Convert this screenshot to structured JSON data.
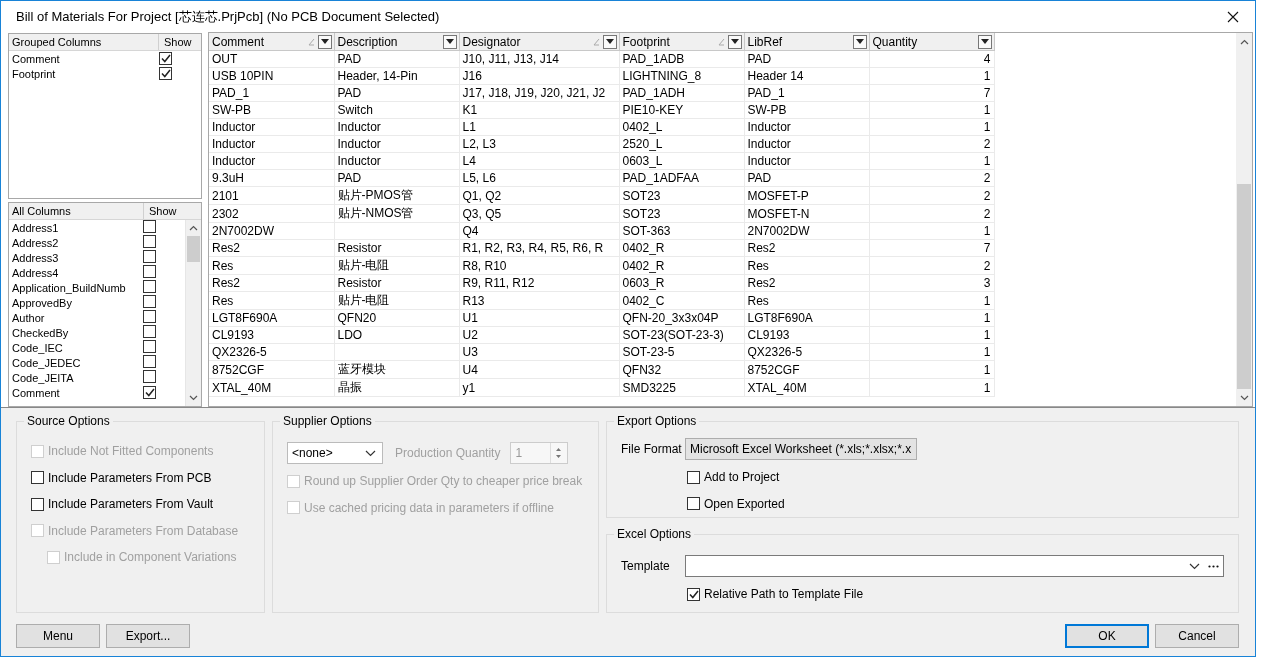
{
  "window": {
    "title": "Bill of Materials For Project [芯连芯.PrjPcb] (No PCB Document Selected)"
  },
  "grouped_columns": {
    "headers": [
      "Grouped Columns",
      "Show"
    ],
    "items": [
      {
        "label": "Comment",
        "checked": true
      },
      {
        "label": "Footprint",
        "checked": true
      }
    ]
  },
  "all_columns": {
    "headers": [
      "All Columns",
      "Show"
    ],
    "items": [
      {
        "label": "Address1",
        "checked": false
      },
      {
        "label": "Address2",
        "checked": false
      },
      {
        "label": "Address3",
        "checked": false
      },
      {
        "label": "Address4",
        "checked": false
      },
      {
        "label": "Application_BuildNumb",
        "checked": false
      },
      {
        "label": "ApprovedBy",
        "checked": false
      },
      {
        "label": "Author",
        "checked": false
      },
      {
        "label": "CheckedBy",
        "checked": false
      },
      {
        "label": "Code_IEC",
        "checked": false
      },
      {
        "label": "Code_JEDEC",
        "checked": false
      },
      {
        "label": "Code_JEITA",
        "checked": false
      },
      {
        "label": "Comment",
        "checked": true
      }
    ]
  },
  "table": {
    "columns": [
      {
        "label": "Comment",
        "sorted": true,
        "kind": "text"
      },
      {
        "label": "Description",
        "sorted": false,
        "kind": "text"
      },
      {
        "label": "Designator",
        "sorted": true,
        "kind": "text"
      },
      {
        "label": "Footprint",
        "sorted": true,
        "kind": "text"
      },
      {
        "label": "LibRef",
        "sorted": false,
        "kind": "text"
      },
      {
        "label": "Quantity",
        "sorted": false,
        "kind": "number"
      }
    ],
    "rows": [
      [
        "OUT",
        "PAD",
        "J10, J11, J13, J14",
        "PAD_1ADB",
        "PAD",
        "4"
      ],
      [
        "USB 10PIN",
        "Header, 14-Pin",
        "J16",
        "LIGHTNING_8",
        "Header 14",
        "1"
      ],
      [
        "PAD_1",
        "PAD",
        "J17, J18, J19, J20, J21, J2",
        "PAD_1ADH",
        "PAD_1",
        "7"
      ],
      [
        "SW-PB",
        "Switch",
        "K1",
        "PIE10-KEY",
        "SW-PB",
        "1"
      ],
      [
        "Inductor",
        "Inductor",
        "L1",
        "0402_L",
        "Inductor",
        "1"
      ],
      [
        "Inductor",
        "Inductor",
        "L2, L3",
        "2520_L",
        "Inductor",
        "2"
      ],
      [
        "Inductor",
        "Inductor",
        "L4",
        "0603_L",
        "Inductor",
        "1"
      ],
      [
        "9.3uH",
        "PAD",
        "L5, L6",
        "PAD_1ADFAA",
        "PAD",
        "2"
      ],
      [
        "2101",
        "贴片-PMOS管",
        "Q1, Q2",
        "SOT23",
        "MOSFET-P",
        "2"
      ],
      [
        "2302",
        "贴片-NMOS管",
        "Q3, Q5",
        "SOT23",
        "MOSFET-N",
        "2"
      ],
      [
        "2N7002DW",
        null,
        "Q4",
        "SOT-363",
        "2N7002DW",
        "1"
      ],
      [
        "Res2",
        "Resistor",
        "R1, R2, R3, R4, R5, R6, R",
        "0402_R",
        "Res2",
        "7"
      ],
      [
        "Res",
        "贴片-电阻",
        "R8, R10",
        "0402_R",
        "Res",
        "2"
      ],
      [
        "Res2",
        "Resistor",
        "R9, R11, R12",
        "0603_R",
        "Res2",
        "3"
      ],
      [
        "Res",
        "贴片-电阻",
        "R13",
        "0402_C",
        "Res",
        "1"
      ],
      [
        "LGT8F690A",
        "QFN20",
        "U1",
        "QFN-20_3x3x04P",
        "LGT8F690A",
        "1"
      ],
      [
        "CL9193",
        "LDO",
        "U2",
        "SOT-23(SOT-23-3)",
        "CL9193",
        "1"
      ],
      [
        "QX2326-5",
        null,
        "U3",
        "SOT-23-5",
        "QX2326-5",
        "1"
      ],
      [
        "8752CGF",
        "蓝牙模块",
        "U4",
        "QFN32",
        "8752CGF",
        "1"
      ],
      [
        "XTAL_40M",
        "晶振",
        "y1",
        "SMD3225",
        "XTAL_40M",
        "1"
      ]
    ]
  },
  "source_options": {
    "title": "Source Options",
    "options": [
      {
        "label": "Include Not Fitted Components",
        "checked": false,
        "disabled": true
      },
      {
        "label": "Include Parameters From PCB",
        "checked": false,
        "disabled": false
      },
      {
        "label": "Include Parameters From Vault",
        "checked": false,
        "disabled": false
      },
      {
        "label": "Include Parameters From Database",
        "checked": false,
        "disabled": true,
        "children": [
          {
            "label": "Include in Component Variations",
            "checked": false,
            "disabled": true
          }
        ]
      }
    ]
  },
  "supplier_options": {
    "title": "Supplier Options",
    "supplier": {
      "value": "<none>"
    },
    "quantity_label": "Production Quantity",
    "quantity": {
      "value": "1",
      "disabled": true
    },
    "options": [
      {
        "label": "Round up Supplier Order Qty to cheaper price break",
        "checked": false,
        "disabled": true
      },
      {
        "label": "Use cached pricing data in parameters if offline",
        "checked": false,
        "disabled": true
      }
    ]
  },
  "export_options": {
    "title": "Export Options",
    "file_format_label": "File Format",
    "file_format": {
      "value": "Microsoft Excel Worksheet (*.xls;*.xlsx;*.x"
    },
    "options": [
      {
        "label": "Add to Project",
        "checked": false,
        "disabled": false
      },
      {
        "label": "Open Exported",
        "checked": false,
        "disabled": false
      }
    ]
  },
  "excel_options": {
    "title": "Excel Options",
    "template_label": "Template",
    "options": [
      {
        "label": "Relative Path to Template File",
        "checked": true,
        "disabled": false
      }
    ]
  },
  "buttons": {
    "left": [
      {
        "label": "Menu",
        "default": false
      },
      {
        "label": "Export...",
        "default": false
      }
    ],
    "right": [
      {
        "label": "OK",
        "default": true
      },
      {
        "label": "Cancel",
        "default": false
      }
    ]
  }
}
